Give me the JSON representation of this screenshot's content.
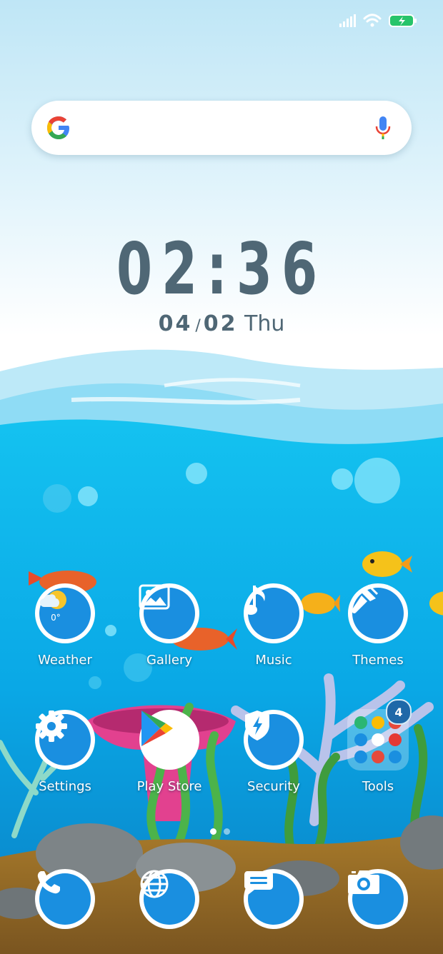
{
  "status_bar": {
    "signal_icon": "signal-icon",
    "wifi_icon": "wifi-icon",
    "battery_icon": "battery-charging-icon"
  },
  "search": {
    "logo_icon": "google-logo-icon",
    "mic_icon": "microphone-icon"
  },
  "clock": {
    "hours": "02",
    "separator": ":",
    "minutes": "36"
  },
  "date": {
    "month": "04",
    "slash": "/",
    "day": "02",
    "weekday": "Thu"
  },
  "apps_row1": [
    {
      "label": "Weather",
      "icon": "weather-icon",
      "temp": "0°"
    },
    {
      "label": "Gallery",
      "icon": "gallery-icon"
    },
    {
      "label": "Music",
      "icon": "music-note-icon"
    },
    {
      "label": "Themes",
      "icon": "paintbrush-icon"
    }
  ],
  "apps_row2": [
    {
      "label": "Settings",
      "icon": "gear-icon"
    },
    {
      "label": "Play Store",
      "icon": "play-store-icon"
    },
    {
      "label": "Security",
      "icon": "shield-icon"
    },
    {
      "label": "Tools",
      "icon": "folder-icon",
      "badge": "4"
    }
  ],
  "dock": [
    {
      "name": "Phone",
      "icon": "phone-icon"
    },
    {
      "name": "Browser",
      "icon": "globe-icon"
    },
    {
      "name": "Messages",
      "icon": "message-icon"
    },
    {
      "name": "Camera",
      "icon": "camera-icon"
    }
  ],
  "page_indicator": {
    "pages": 2,
    "active": 1
  },
  "colors": {
    "icon_blue": "#1a8fe0",
    "text_dark": "#4f6775",
    "badge_blue": "#1f68a8"
  }
}
